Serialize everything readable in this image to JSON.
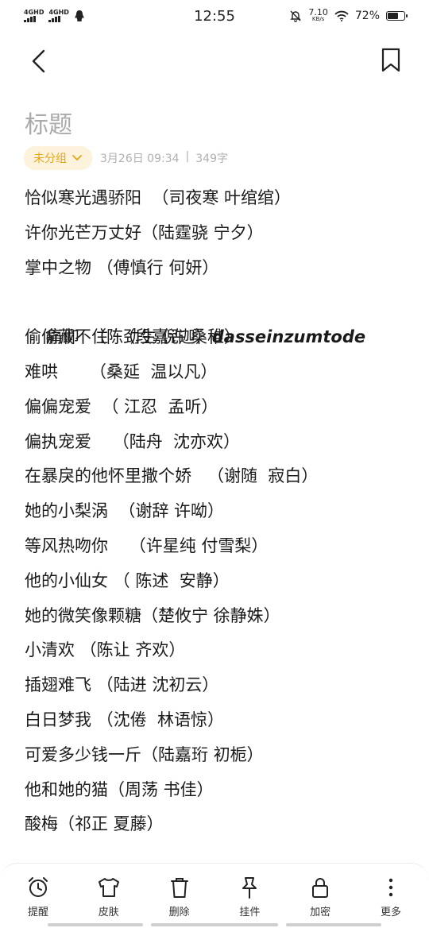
{
  "status_bar": {
    "signal1": "4GHD",
    "signal2": "4GHD",
    "time": "12:55",
    "speed_value": "7.10",
    "speed_unit": "KB/s",
    "battery": "72%",
    "battery_level": 0.72
  },
  "note": {
    "title": "标题",
    "group": "未分组",
    "date": "3月26日 09:34",
    "separator": "|",
    "word_count": "349字"
  },
  "lines": [
    "恰似寒光遇骄阳  （司夜寒 叶绾绾）",
    "许你光芒万丈好（陆霆骁 宁夕）",
    "掌中之物 （傅慎行 何妍）",
    "偷偷藏不住  （段嘉许 桑稚）",
    "难哄      （桑延  温以凡）",
    "偏偏宠爱  （ 江忍  孟听）",
    "偏执宠爱    （陆舟  沈亦欢）",
    "在暴戾的他怀里撒个娇   （谢随  寂白）",
    "她的小梨涡  （谢辞 许呦）",
    "等风热吻你    （许星纯 付雪梨）",
    "他的小仙女 （ 陈述  安静）",
    "她的微笑像颗糖（楚攸宁 徐静姝）",
    "小清欢 （陈让 齐欢）",
    "插翅难飞 （陆进 沈初云）",
    "白日梦我 （沈倦  林语惊）",
    "可爱多少钱一斤（陆嘉珩 初栀）",
    "他和她的猫（周荡 书佳）",
    "酸梅（祁正 夏藤）"
  ],
  "special_line": {
    "text": "痛仰  （陈劲生 倪迦）",
    "emphasis": "dasseinzumtode"
  },
  "toolbar": {
    "remind": "提醒",
    "skin": "皮肤",
    "delete": "删除",
    "widget": "挂件",
    "encrypt": "加密",
    "more": "更多"
  }
}
